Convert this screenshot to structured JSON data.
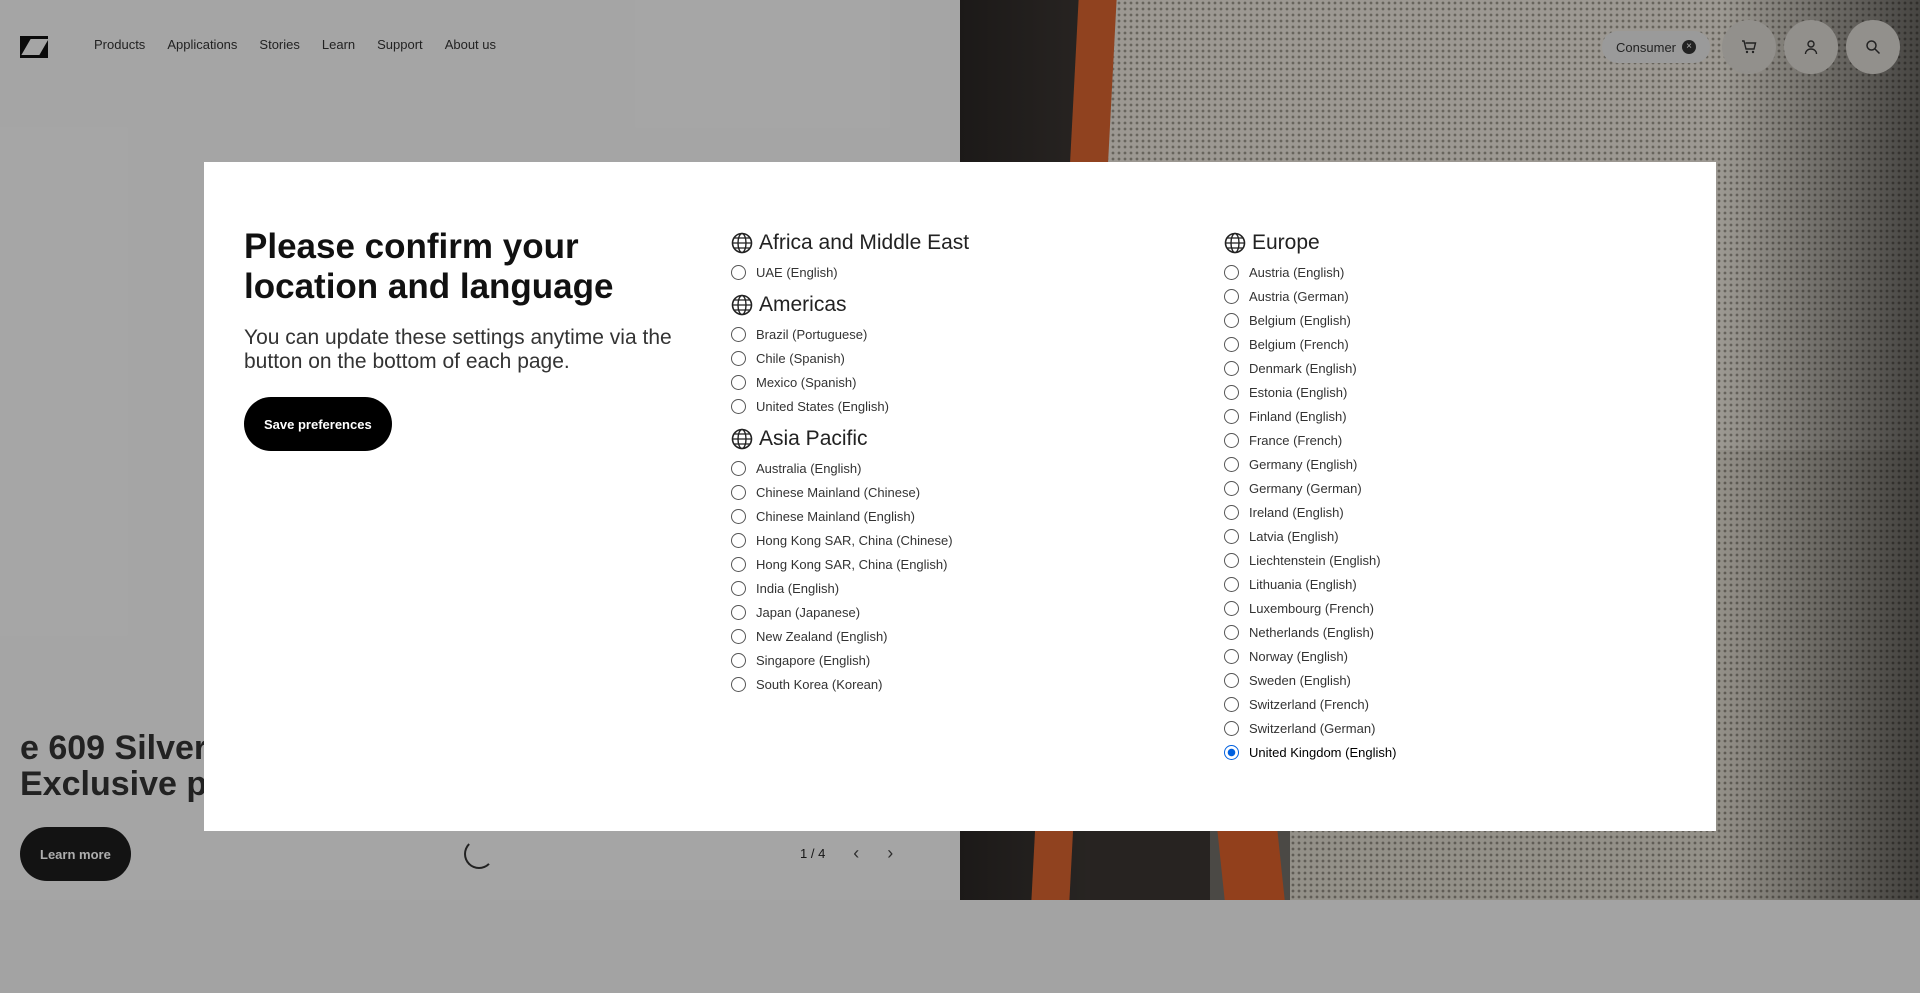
{
  "header": {
    "nav": [
      "Products",
      "Applications",
      "Stories",
      "Learn",
      "Support",
      "About us"
    ],
    "consumer_label": "Consumer",
    "consumer_badge": "×"
  },
  "hero": {
    "title_line1": "e 609 Silver",
    "title_line2": "Exclusive pr",
    "learn_more": "Learn more",
    "pager": "1 / 4"
  },
  "modal": {
    "title": "Please confirm your location and language",
    "subtitle": "You can update these settings anytime via the button on the bottom of each page.",
    "save_label": "Save preferences",
    "regions_mid": [
      {
        "name": "Africa and Middle East",
        "options": [
          "UAE (English)"
        ]
      },
      {
        "name": "Americas",
        "options": [
          "Brazil (Portuguese)",
          "Chile (Spanish)",
          "Mexico (Spanish)",
          "United States (English)"
        ]
      },
      {
        "name": "Asia Pacific",
        "options": [
          "Australia (English)",
          "Chinese Mainland (Chinese)",
          "Chinese Mainland (English)",
          "Hong Kong SAR, China (Chinese)",
          "Hong Kong SAR, China (English)",
          "India (English)",
          "Japan (Japanese)",
          "New Zealand (English)",
          "Singapore (English)",
          "South Korea (Korean)"
        ]
      }
    ],
    "regions_right": [
      {
        "name": "Europe",
        "options": [
          "Austria (English)",
          "Austria (German)",
          "Belgium (English)",
          "Belgium (French)",
          "Denmark (English)",
          "Estonia (English)",
          "Finland (English)",
          "France (French)",
          "Germany (English)",
          "Germany (German)",
          "Ireland (English)",
          "Latvia (English)",
          "Liechtenstein (English)",
          "Lithuania (English)",
          "Luxembourg (French)",
          "Netherlands (English)",
          "Norway (English)",
          "Sweden (English)",
          "Switzerland (French)",
          "Switzerland (German)",
          "United Kingdom (English)"
        ]
      }
    ],
    "selected": "United Kingdom (English)"
  },
  "colors": {
    "accent": "#0060df",
    "button": "#000000"
  }
}
